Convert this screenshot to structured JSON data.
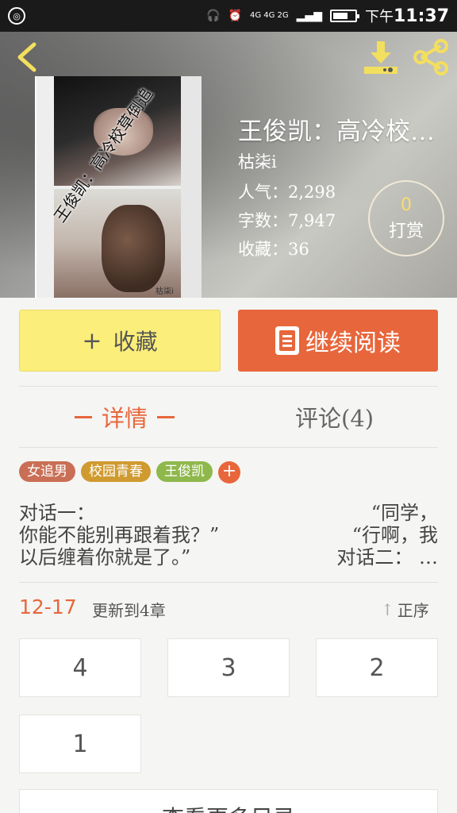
{
  "status_bar": {
    "network": "4G 4G\n2G",
    "ampm": "下午",
    "time": "11:37"
  },
  "book": {
    "title": "王俊凯：高冷校…",
    "author": "枯柒i",
    "popularity": "人气：2,298",
    "word_count": "字数：7,947",
    "favorites": "收藏：36",
    "cover_title": "王俊凯：高冷校草倒追",
    "cover_author": "枯柒i"
  },
  "tip": {
    "count": "0",
    "label": "打赏"
  },
  "actions": {
    "collect_plus": "+",
    "collect_label": "收藏",
    "read_label": "继续阅读"
  },
  "tabs": {
    "details": "详情",
    "comments": "评论(4)"
  },
  "tags": [
    "女追男",
    "校园青春",
    "王俊凯"
  ],
  "tag_add": "+",
  "synopsis": {
    "line1_left": "对话一：",
    "line1_right": "“同学，",
    "line2_left": "你能不能别再跟着我？”",
    "line2_right": "“行啊，我",
    "line3_left": "以后缠着你就是了。”",
    "line3_right": "对话二：  …"
  },
  "update": {
    "date": "12-17",
    "text": "更新到4章",
    "sort_arrow": "↑",
    "sort_label": "正序"
  },
  "chapters": [
    "4",
    "3",
    "2",
    "1"
  ],
  "more_label": "查看更多目录",
  "colors": {
    "accent": "#e8663b",
    "collect_button": "#fbee7a",
    "tag_1": "#c96f55",
    "tag_2": "#cf9a2f",
    "tag_3": "#8fb84c"
  }
}
